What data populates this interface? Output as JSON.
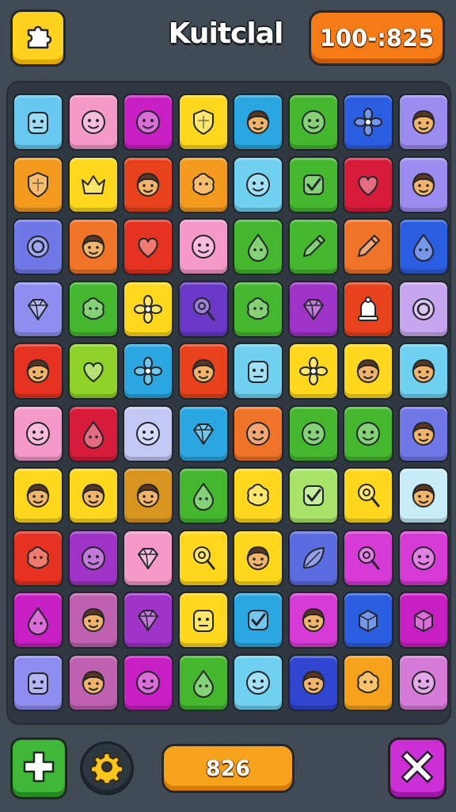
{
  "header": {
    "title": "Kuitclal",
    "score": "100-:825",
    "menu_icon": "puzzle-piece-icon"
  },
  "footer": {
    "score": "826",
    "add_icon": "plus-icon",
    "settings_icon": "gear-icon",
    "close_icon": "close-icon"
  },
  "board": {
    "columns": 8,
    "rows": 10,
    "tiles": [
      [
        {
          "c": "#67c9ef",
          "i": "robot"
        },
        {
          "c": "#f59ac8",
          "i": "face"
        },
        {
          "c": "#c81fc4",
          "i": "face"
        },
        {
          "c": "#ffd81e",
          "i": "shield"
        },
        {
          "c": "#2aa7e0",
          "i": "person"
        },
        {
          "c": "#45b72f",
          "i": "face"
        },
        {
          "c": "#2b5de0",
          "i": "flower"
        },
        {
          "c": "#9d8cf0",
          "i": "person"
        }
      ],
      [
        {
          "c": "#f39a1e",
          "i": "shield"
        },
        {
          "c": "#ffd81e",
          "i": "crown"
        },
        {
          "c": "#e7421c",
          "i": "person"
        },
        {
          "c": "#f39a1e",
          "i": "blob"
        },
        {
          "c": "#6fd0ef",
          "i": "face"
        },
        {
          "c": "#45b72f",
          "i": "check"
        },
        {
          "c": "#d71c3b",
          "i": "heart"
        },
        {
          "c": "#9d8cf0",
          "i": "person"
        }
      ],
      [
        {
          "c": "#6f78e6",
          "i": "ring"
        },
        {
          "c": "#f07428",
          "i": "person"
        },
        {
          "c": "#e63220",
          "i": "heart"
        },
        {
          "c": "#f59ac8",
          "i": "face"
        },
        {
          "c": "#45b72f",
          "i": "drop"
        },
        {
          "c": "#45b72f",
          "i": "pen"
        },
        {
          "c": "#f07428",
          "i": "pen"
        },
        {
          "c": "#2b5de0",
          "i": "drop"
        }
      ],
      [
        {
          "c": "#8f8ef0",
          "i": "gem"
        },
        {
          "c": "#45b72f",
          "i": "blob"
        },
        {
          "c": "#ffd81e",
          "i": "flower"
        },
        {
          "c": "#6a39c8",
          "i": "lollipop"
        },
        {
          "c": "#45b72f",
          "i": "blob"
        },
        {
          "c": "#a033c7",
          "i": "gem"
        },
        {
          "c": "#e7421c",
          "i": "bell"
        },
        {
          "c": "#c7a6f0",
          "i": "ring"
        }
      ],
      [
        {
          "c": "#e63220",
          "i": "person"
        },
        {
          "c": "#8fd22a",
          "i": "heart"
        },
        {
          "c": "#2aa7e0",
          "i": "flower"
        },
        {
          "c": "#e7421c",
          "i": "person"
        },
        {
          "c": "#6fd0ef",
          "i": "robot"
        },
        {
          "c": "#ffd81e",
          "i": "flower"
        },
        {
          "c": "#ffd81e",
          "i": "person"
        },
        {
          "c": "#6fd0ef",
          "i": "person"
        }
      ],
      [
        {
          "c": "#f59ac8",
          "i": "face"
        },
        {
          "c": "#d71c3b",
          "i": "drop"
        },
        {
          "c": "#c2c8f3",
          "i": "face"
        },
        {
          "c": "#2aa7e0",
          "i": "gem"
        },
        {
          "c": "#f07428",
          "i": "face"
        },
        {
          "c": "#45b72f",
          "i": "face"
        },
        {
          "c": "#45b72f",
          "i": "face"
        },
        {
          "c": "#6f78e6",
          "i": "person"
        }
      ],
      [
        {
          "c": "#ffd81e",
          "i": "person"
        },
        {
          "c": "#ffd81e",
          "i": "person"
        },
        {
          "c": "#d7941f",
          "i": "person"
        },
        {
          "c": "#45b72f",
          "i": "drop"
        },
        {
          "c": "#ffd81e",
          "i": "blob"
        },
        {
          "c": "#a9e46a",
          "i": "check"
        },
        {
          "c": "#ffd81e",
          "i": "lollipop"
        },
        {
          "c": "#c8ecf8",
          "i": "person"
        }
      ],
      [
        {
          "c": "#e63220",
          "i": "blob"
        },
        {
          "c": "#a033c7",
          "i": "face"
        },
        {
          "c": "#f59ac8",
          "i": "gem"
        },
        {
          "c": "#ffd81e",
          "i": "lollipop"
        },
        {
          "c": "#ffd81e",
          "i": "person"
        },
        {
          "c": "#5a6ce0",
          "i": "leaf"
        },
        {
          "c": "#d63bd6",
          "i": "lollipop"
        },
        {
          "c": "#d63bd6",
          "i": "face"
        }
      ],
      [
        {
          "c": "#c81fc4",
          "i": "drop"
        },
        {
          "c": "#c060b0",
          "i": "person"
        },
        {
          "c": "#a033c7",
          "i": "gem"
        },
        {
          "c": "#ffd81e",
          "i": "robot"
        },
        {
          "c": "#2aa7e0",
          "i": "check"
        },
        {
          "c": "#d63bd6",
          "i": "person"
        },
        {
          "c": "#2b5de0",
          "i": "box"
        },
        {
          "c": "#c81fc4",
          "i": "box"
        }
      ],
      [
        {
          "c": "#8f8ef0",
          "i": "robot"
        },
        {
          "c": "#c060b0",
          "i": "person"
        },
        {
          "c": "#c81fc4",
          "i": "face"
        },
        {
          "c": "#45b72f",
          "i": "drop"
        },
        {
          "c": "#6fd0ef",
          "i": "face"
        },
        {
          "c": "#3046d0",
          "i": "person"
        },
        {
          "c": "#f6a21c",
          "i": "blob"
        },
        {
          "c": "#d67ad8",
          "i": "face"
        }
      ]
    ]
  }
}
